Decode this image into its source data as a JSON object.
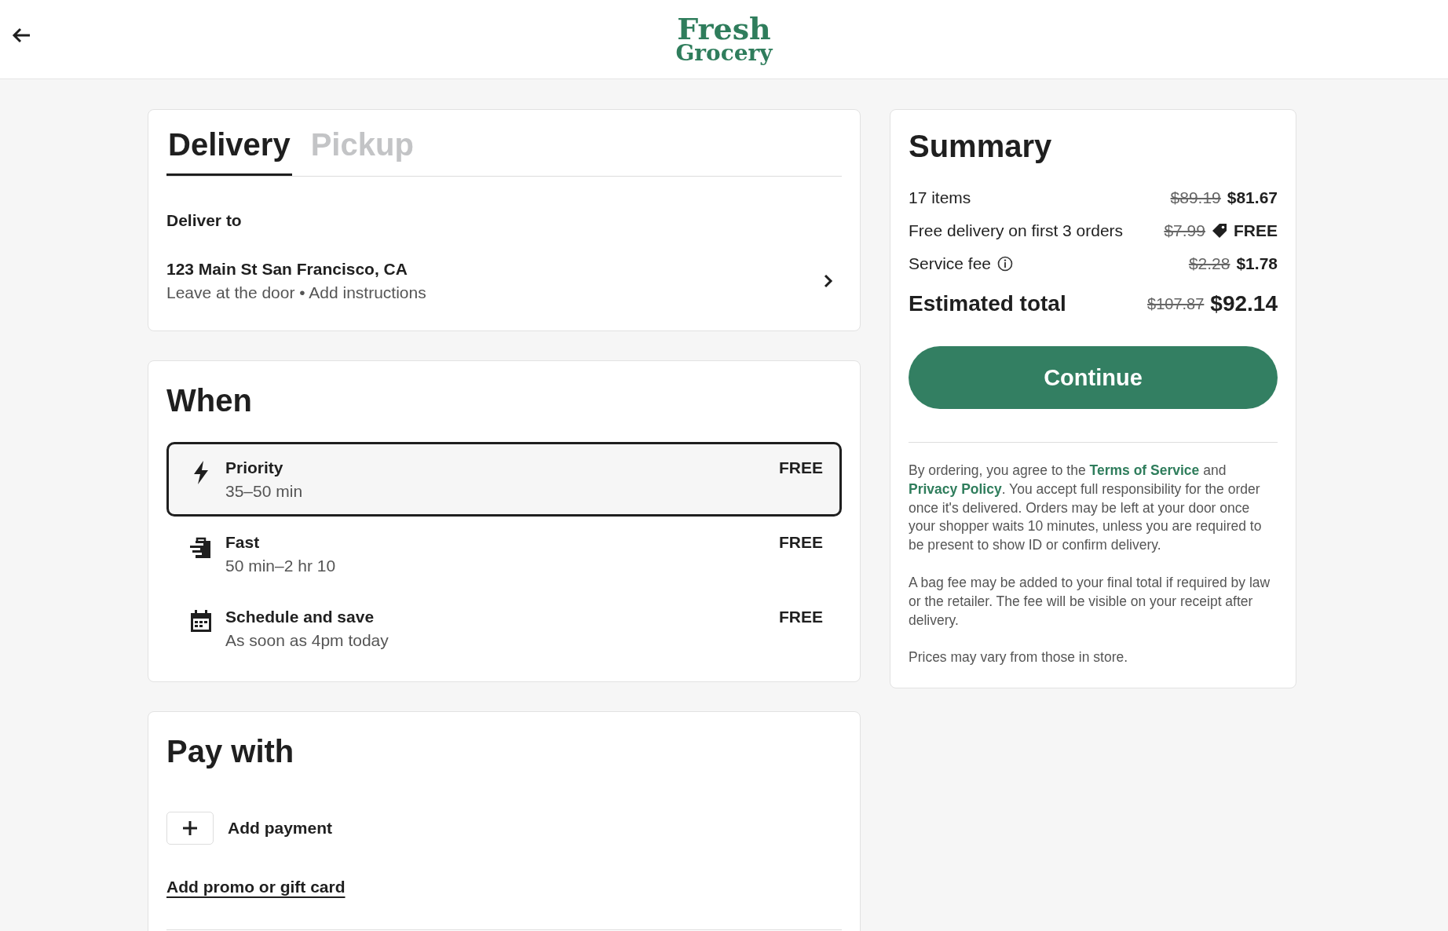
{
  "header": {
    "logo_line_1": "Fresh",
    "logo_line_2": "Grocery"
  },
  "tabs": [
    {
      "label": "Delivery",
      "selected": true
    },
    {
      "label": "Pickup",
      "selected": false
    }
  ],
  "deliver_to": {
    "label": "Deliver to",
    "address": "123 Main St San Francisco, CA",
    "instructions": "Leave at the door • Add instructions"
  },
  "when": {
    "title": "When",
    "options": [
      {
        "kind": "bolt",
        "name": "Priority",
        "time": "35–50 min",
        "price": "FREE",
        "selected": true
      },
      {
        "kind": "bag",
        "name": "Fast",
        "time": "50 min–2 hr 10",
        "price": "FREE",
        "selected": false
      },
      {
        "kind": "calendar",
        "name": "Schedule and save",
        "time": "As soon as 4pm today",
        "price": "FREE",
        "selected": false
      }
    ]
  },
  "pay_with": {
    "title": "Pay with",
    "add_payment": "Add payment",
    "promo_link": "Add promo or gift card"
  },
  "summary": {
    "title": "Summary",
    "lines": [
      {
        "label": "17 items",
        "info": false,
        "tag": false,
        "old_price": "$89.19",
        "price": "$81.67"
      },
      {
        "label": "Free delivery on first 3 orders",
        "info": false,
        "tag": true,
        "old_price": "$7.99",
        "price": "FREE"
      },
      {
        "label": "Service fee",
        "info": true,
        "tag": false,
        "old_price": "$2.28",
        "price": "$1.78"
      }
    ],
    "total": {
      "label": "Estimated total",
      "old_price": "$107.87",
      "price": "$92.14"
    },
    "continue_button": "Continue",
    "legal": [
      [
        {
          "kind": "text",
          "text": "By ordering, you agree to the "
        },
        {
          "kind": "link",
          "text": "Terms of Service"
        },
        {
          "kind": "text",
          "text": " and "
        },
        {
          "kind": "link",
          "text": "Privacy Policy"
        },
        {
          "kind": "text",
          "text": ". You accept full responsibility for the order once it's delivered. Orders may be left at your door once your shopper waits 10 minutes, unless you are required to be present to show ID or confirm delivery."
        }
      ],
      [
        {
          "kind": "text",
          "text": "A bag fee may be added to your final total if required by law or the retailer. The fee will be visible on your receipt after delivery."
        }
      ],
      [
        {
          "kind": "text",
          "text": "Prices may vary from those in store."
        }
      ]
    ]
  }
}
